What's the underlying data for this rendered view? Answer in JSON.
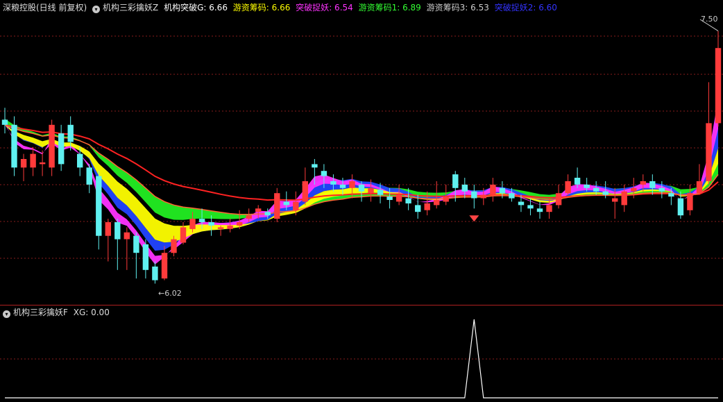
{
  "header": {
    "stock_label": "深粮控股(日线 前复权)",
    "main_indicator": "机构三彩擒妖Z",
    "legend": [
      {
        "text": "机构突破G: 6.66",
        "color": "#ffffff"
      },
      {
        "text": "游资筹码: 6.66",
        "color": "#ffff00"
      },
      {
        "text": "突破捉妖: 6.54",
        "color": "#ff33ff"
      },
      {
        "text": "游资筹码1: 6.89",
        "color": "#33ff33"
      },
      {
        "text": "游资筹码3: 6.53",
        "color": "#cccccc"
      },
      {
        "text": "突破捉妖2: 6.60",
        "color": "#3333ff"
      }
    ]
  },
  "sub_header": {
    "indicator": "机构三彩擒妖F",
    "value_text": "XG: 0.00"
  },
  "annotations": {
    "high": "7.50",
    "low": "6.02"
  },
  "icons": {
    "panel_toggle": "chevron-down-icon",
    "signal": "red-gem-icon"
  },
  "colors": {
    "up": "#ff3b3b",
    "down": "#5ff0f0",
    "grid": "#8a1c1c",
    "green_ribbon": "#22ee22",
    "yellow_band": "#ffff00",
    "magenta_band": "#ff33ff",
    "blue_ribbon": "#2244ff",
    "red_line": "#ff2222",
    "signal_line": "#ffffff"
  },
  "chart_data": {
    "type": "candlestick",
    "price_range": [
      5.9,
      7.6
    ],
    "candles": [
      [
        6.98,
        6.95,
        7.05,
        6.9
      ],
      [
        6.95,
        6.7,
        7.0,
        6.65
      ],
      [
        6.7,
        6.75,
        6.78,
        6.62
      ],
      [
        6.7,
        6.78,
        6.82,
        6.65
      ],
      [
        6.72,
        6.73,
        6.8,
        6.65
      ],
      [
        6.7,
        6.95,
        6.98,
        6.65
      ],
      [
        6.9,
        6.72,
        6.95,
        6.68
      ],
      [
        6.95,
        6.85,
        7.0,
        6.8
      ],
      [
        6.78,
        6.7,
        6.82,
        6.65
      ],
      [
        6.7,
        6.6,
        6.72,
        6.55
      ],
      [
        6.65,
        6.3,
        6.68,
        6.22
      ],
      [
        6.3,
        6.38,
        6.4,
        6.15
      ],
      [
        6.38,
        6.28,
        6.4,
        6.1
      ],
      [
        6.28,
        6.32,
        6.35,
        6.1
      ],
      [
        6.3,
        6.2,
        6.32,
        6.05
      ],
      [
        6.25,
        6.1,
        6.28,
        6.05
      ],
      [
        6.12,
        6.04,
        6.15,
        6.02
      ],
      [
        6.05,
        6.2,
        6.24,
        6.04
      ],
      [
        6.2,
        6.28,
        6.3,
        6.18
      ],
      [
        6.26,
        6.35,
        6.38,
        6.25
      ],
      [
        6.34,
        6.4,
        6.44,
        6.32
      ],
      [
        6.4,
        6.38,
        6.46,
        6.34
      ],
      [
        6.38,
        6.36,
        6.42,
        6.3
      ],
      [
        6.34,
        6.35,
        6.36,
        6.3
      ],
      [
        6.34,
        6.36,
        6.4,
        6.32
      ],
      [
        6.36,
        6.38,
        6.45,
        6.34
      ],
      [
        6.4,
        6.42,
        6.46,
        6.38
      ],
      [
        6.44,
        6.46,
        6.48,
        6.4
      ],
      [
        6.44,
        6.42,
        6.46,
        6.4
      ],
      [
        6.4,
        6.55,
        6.58,
        6.38
      ],
      [
        6.5,
        6.48,
        6.56,
        6.45
      ],
      [
        6.45,
        6.5,
        6.56,
        6.42
      ],
      [
        6.5,
        6.62,
        6.7,
        6.48
      ],
      [
        6.72,
        6.7,
        6.75,
        6.6
      ],
      [
        6.68,
        6.65,
        6.72,
        6.58
      ],
      [
        6.62,
        6.6,
        6.66,
        6.56
      ],
      [
        6.6,
        6.58,
        6.64,
        6.54
      ],
      [
        6.58,
        6.62,
        6.66,
        6.52
      ],
      [
        6.6,
        6.56,
        6.62,
        6.5
      ],
      [
        6.55,
        6.58,
        6.63,
        6.5
      ],
      [
        6.57,
        6.54,
        6.61,
        6.49
      ],
      [
        6.53,
        6.51,
        6.58,
        6.46
      ],
      [
        6.5,
        6.54,
        6.6,
        6.48
      ],
      [
        6.52,
        6.49,
        6.58,
        6.45
      ],
      [
        6.48,
        6.44,
        6.54,
        6.4
      ],
      [
        6.45,
        6.49,
        6.56,
        6.42
      ],
      [
        6.48,
        6.51,
        6.62,
        6.46
      ],
      [
        6.5,
        6.53,
        6.6,
        6.48
      ],
      [
        6.66,
        6.58,
        6.68,
        6.5
      ],
      [
        6.6,
        6.56,
        6.64,
        6.52
      ],
      [
        6.56,
        6.52,
        6.6,
        6.46
      ],
      [
        6.52,
        6.54,
        6.58,
        6.48
      ],
      [
        6.54,
        6.6,
        6.64,
        6.5
      ],
      [
        6.58,
        6.55,
        6.62,
        6.52
      ],
      [
        6.55,
        6.52,
        6.58,
        6.5
      ],
      [
        6.5,
        6.48,
        6.54,
        6.44
      ],
      [
        6.48,
        6.46,
        6.52,
        6.42
      ],
      [
        6.46,
        6.44,
        6.5,
        6.4
      ],
      [
        6.44,
        6.48,
        6.52,
        6.4
      ],
      [
        6.48,
        6.55,
        6.6,
        6.46
      ],
      [
        6.55,
        6.62,
        6.66,
        6.54
      ],
      [
        6.64,
        6.6,
        6.7,
        6.58
      ],
      [
        6.6,
        6.58,
        6.64,
        6.56
      ],
      [
        6.58,
        6.56,
        6.62,
        6.54
      ],
      [
        6.56,
        6.54,
        6.62,
        6.52
      ],
      [
        6.5,
        6.52,
        6.58,
        6.4
      ],
      [
        6.48,
        6.56,
        6.6,
        6.44
      ],
      [
        6.56,
        6.58,
        6.64,
        6.52
      ],
      [
        6.6,
        6.62,
        6.66,
        6.56
      ],
      [
        6.62,
        6.58,
        6.66,
        6.54
      ],
      [
        6.58,
        6.56,
        6.62,
        6.52
      ],
      [
        6.55,
        6.53,
        6.58,
        6.48
      ],
      [
        6.52,
        6.42,
        6.56,
        6.4
      ],
      [
        6.45,
        6.55,
        6.6,
        6.42
      ],
      [
        6.55,
        6.62,
        6.72,
        6.54
      ],
      [
        6.62,
        6.96,
        7.2,
        6.6
      ],
      [
        6.96,
        7.4,
        7.5,
        6.94
      ]
    ],
    "signal": {
      "label": "XG",
      "index": 50,
      "range": [
        0,
        1
      ]
    }
  }
}
